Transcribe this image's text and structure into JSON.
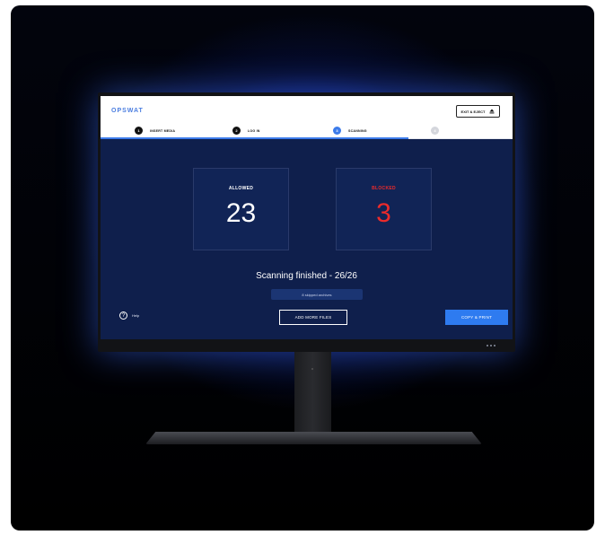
{
  "app": {
    "logo": "OPSWAT",
    "exit_button_label": "EXIT & EJECT"
  },
  "steps": [
    {
      "number": "1",
      "label": "INSERT MEDIA",
      "state": "done"
    },
    {
      "number": "2",
      "label": "LOG IN",
      "state": "done"
    },
    {
      "number": "3",
      "label": "SCANNING",
      "state": "active"
    },
    {
      "number": "4",
      "label": "",
      "state": "disabled"
    }
  ],
  "results": {
    "allowed_label": "ALLOWED",
    "allowed_count": "23",
    "blocked_label": "BLOCKED",
    "blocked_count": "3"
  },
  "status": {
    "text": "Scanning finished - 26/26",
    "skipped": "8 skipped archives"
  },
  "footer": {
    "help_label": "Help",
    "add_more_label": "ADD MORE FILES",
    "copy_print_label": "COPY & PRINT"
  },
  "colors": {
    "accent": "#3c7bea",
    "blocked": "#ec2b2b",
    "screen_bg": "#0f1f4c"
  },
  "icons": {
    "eject": "eject-icon",
    "help": "help-icon"
  }
}
